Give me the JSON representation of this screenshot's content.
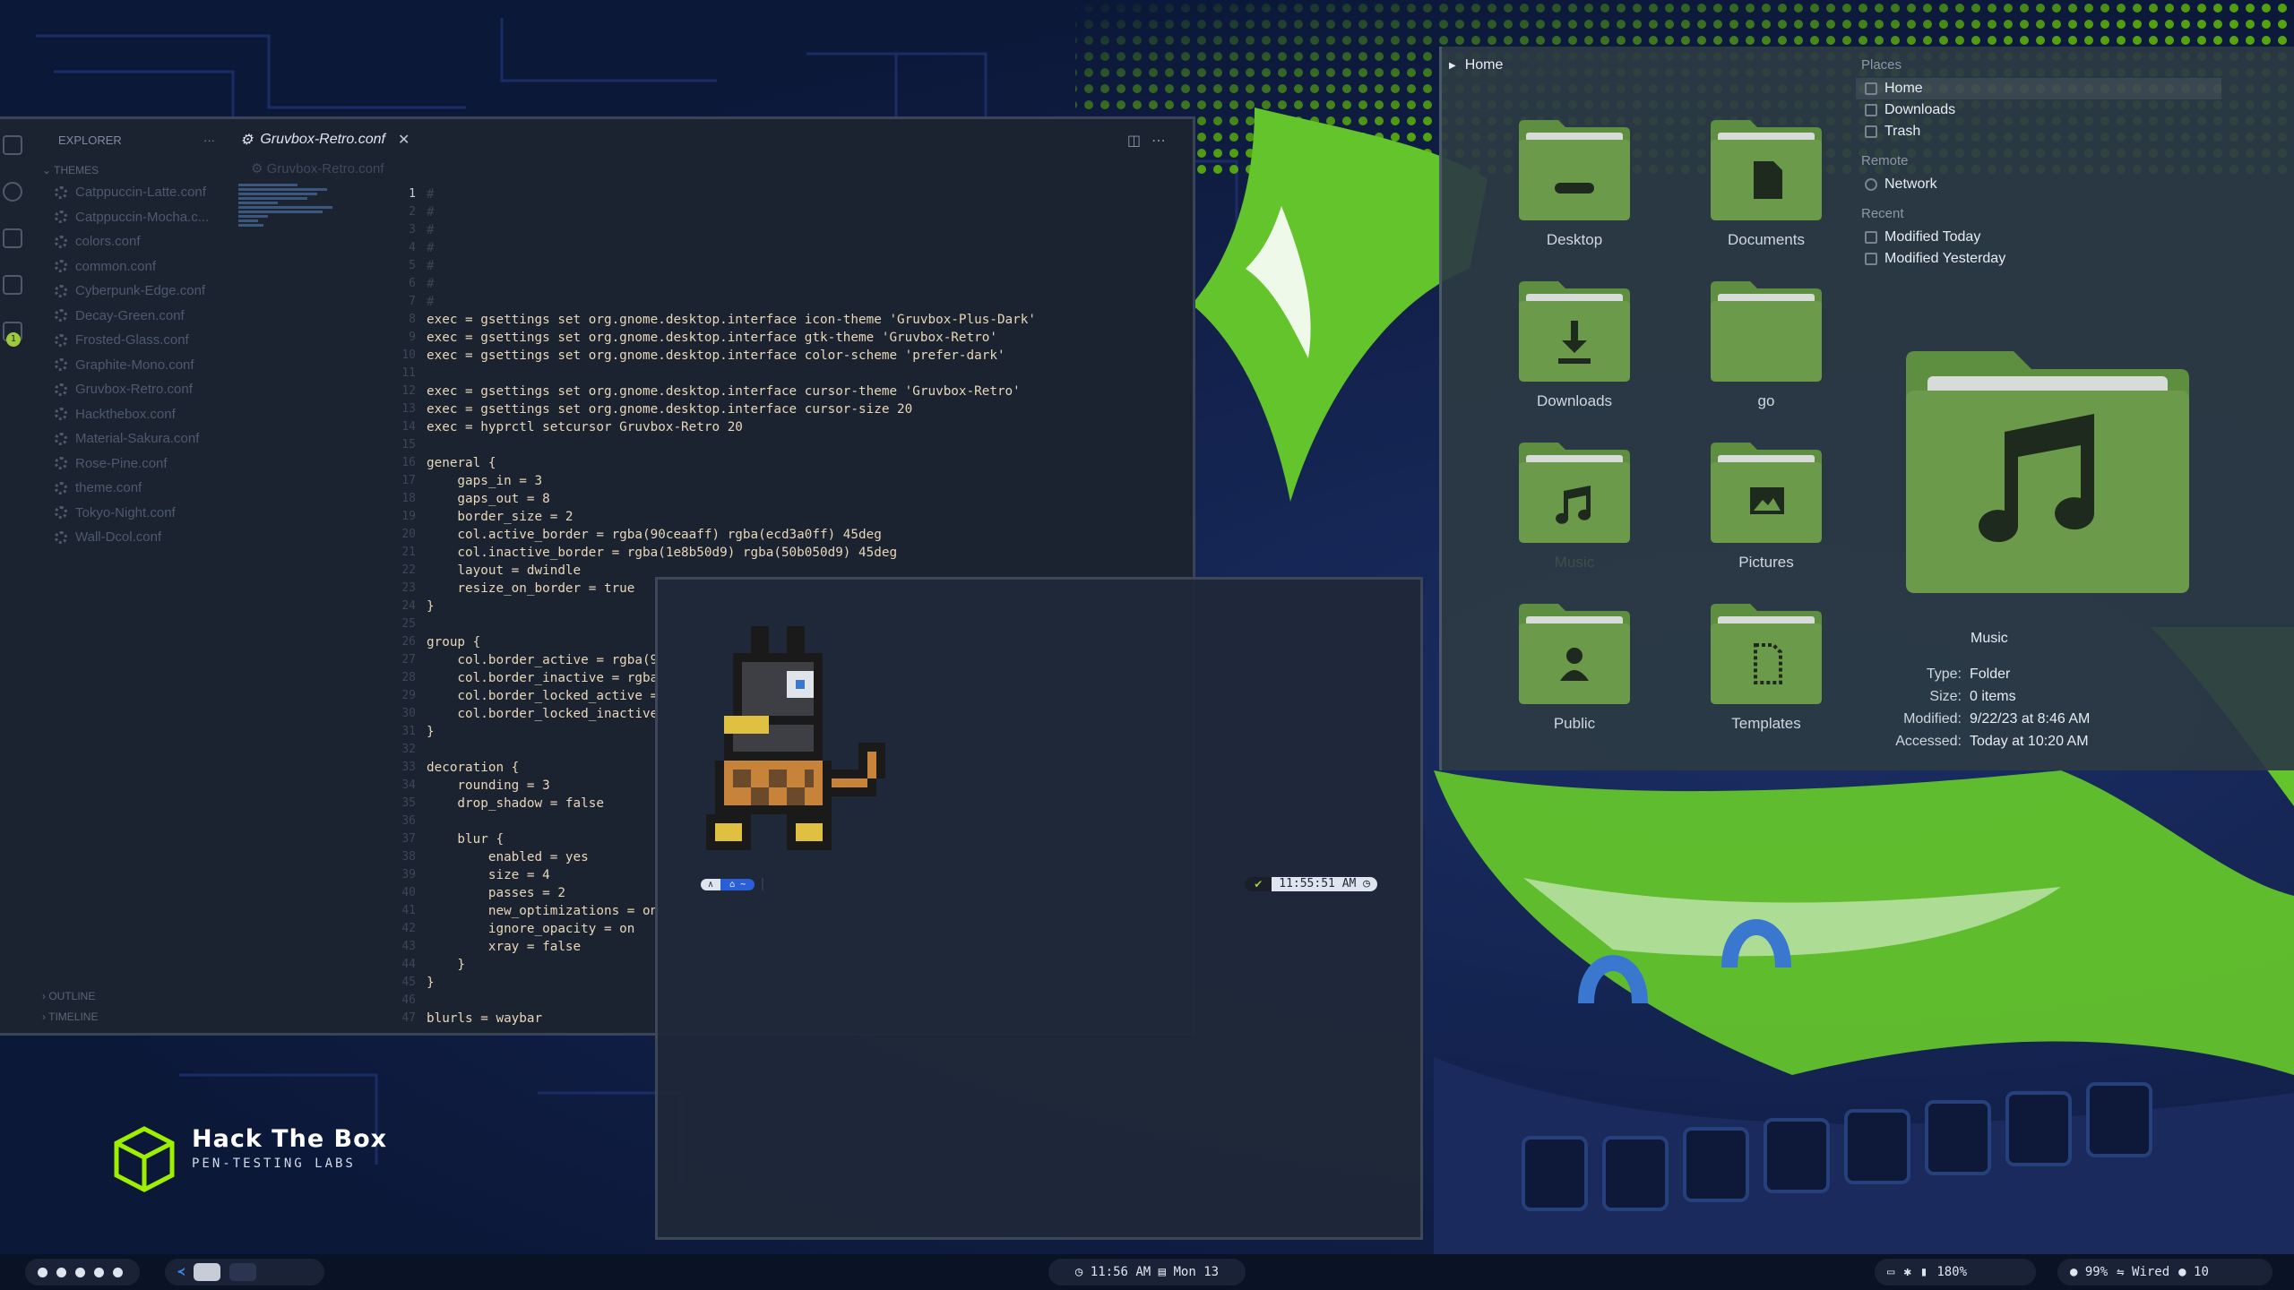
{
  "wallpaper": {
    "brand_name": "Hack The Box",
    "brand_tagline": "PEN-TESTING LABS",
    "accent": "#9fef00"
  },
  "vscode": {
    "explorer_title": "EXPLORER",
    "explorer_menu": "···",
    "section_themes": "THEMES",
    "files": [
      "Catppuccin-Latte.conf",
      "Catppuccin-Mocha.c...",
      "colors.conf",
      "common.conf",
      "Cyberpunk-Edge.conf",
      "Decay-Green.conf",
      "Frosted-Glass.conf",
      "Graphite-Mono.conf",
      "Gruvbox-Retro.conf",
      "Hackthebox.conf",
      "Material-Sakura.conf",
      "Rose-Pine.conf",
      "theme.conf",
      "Tokyo-Night.conf",
      "Wall-Dcol.conf"
    ],
    "section_outline": "OUTLINE",
    "section_timeline": "TIMELINE",
    "badge_count": "1",
    "tab_title": "Gruvbox-Retro.conf",
    "breadcrumb": "Gruvbox-Retro.conf",
    "line_numbers": [
      "1",
      "2",
      "3",
      "4",
      "5",
      "6",
      "7",
      "8",
      "9",
      "10",
      "11",
      "12",
      "13",
      "14",
      "15",
      "16",
      "17",
      "18",
      "19",
      "20",
      "21",
      "22",
      "23",
      "24",
      "25",
      "26",
      "27",
      "28",
      "29",
      "30",
      "31",
      "32",
      "33",
      "34",
      "35",
      "36",
      "37",
      "38",
      "39",
      "40",
      "41",
      "42",
      "43",
      "44",
      "45",
      "46",
      "47"
    ],
    "current_line": "1",
    "code_lines": [
      "exec = gsettings set org.gnome.desktop.interface icon-theme 'Gruvbox-Plus-Dark'",
      "exec = gsettings set org.gnome.desktop.interface gtk-theme 'Gruvbox-Retro'",
      "exec = gsettings set org.gnome.desktop.interface color-scheme 'prefer-dark'",
      "exec = gsettings set org.gnome.desktop.interface cursor-theme 'Gruvbox-Retro'",
      "exec = gsettings set org.gnome.desktop.interface cursor-size 20",
      "exec = hyprctl setcursor Gruvbox-Retro 20",
      "general {",
      "    gaps_in = 3",
      "    gaps_out = 8",
      "    border_size = 2",
      "    col.active_border = rgba(90ceaaff) rgba(ecd3a0ff) 45deg",
      "    col.inactive_border = rgba(1e8b50d9) rgba(50b050d9) 45deg",
      "    layout = dwindle",
      "    resize_on_border = true",
      "}",
      "group {",
      "    col.border_active = rgba(9",
      "    col.border_inactive = rgba",
      "    col.border_locked_active =",
      "    col.border_locked_inactive",
      "}",
      "decoration {",
      "    rounding = 3",
      "    drop_shadow = false",
      "    blur {",
      "        enabled = yes",
      "        size = 4",
      "        passes = 2",
      "        new_optimizations = on",
      "        ignore_opacity = on",
      "        xray = false",
      "    }",
      "}",
      "blurls = waybar"
    ]
  },
  "terminal": {
    "prompt_user": "∧",
    "prompt_dir": "⌂ ~",
    "status_ok": "✔",
    "time": "11:55:51 AM ◷"
  },
  "files": {
    "path": "Home",
    "folders": [
      {
        "label": "Desktop",
        "icon": "desktop-icon"
      },
      {
        "label": "Documents",
        "icon": "document-icon"
      },
      {
        "label": "Downloads",
        "icon": "download-icon"
      },
      {
        "label": "go",
        "icon": "folder-icon"
      },
      {
        "label": "Music",
        "icon": "music-icon"
      },
      {
        "label": "Pictures",
        "icon": "picture-icon"
      },
      {
        "label": "Public",
        "icon": "user-icon"
      },
      {
        "label": "Templates",
        "icon": "template-icon"
      }
    ],
    "sidebar": {
      "places_header": "Places",
      "places": [
        "Home",
        "Downloads",
        "Trash"
      ],
      "remote_header": "Remote",
      "remote": [
        "Network"
      ],
      "recent_header": "Recent",
      "recent": [
        "Modified Today",
        "Modified Yesterday"
      ]
    },
    "preview": {
      "name": "Music",
      "props": [
        {
          "k": "Type:",
          "v": "Folder"
        },
        {
          "k": "Size:",
          "v": "0 items"
        },
        {
          "k": "Modified:",
          "v": "9/22/23 at 8:46 AM"
        },
        {
          "k": "Accessed:",
          "v": "Today at 10:20 AM"
        }
      ]
    },
    "folder_color": "#6a9a4a"
  },
  "taskbar": {
    "clock": "◷ 11:56 AM  ▤ Mon 13",
    "brightness": "180%",
    "battery": "● 99%",
    "network": "Wired",
    "volume": "● 10"
  }
}
